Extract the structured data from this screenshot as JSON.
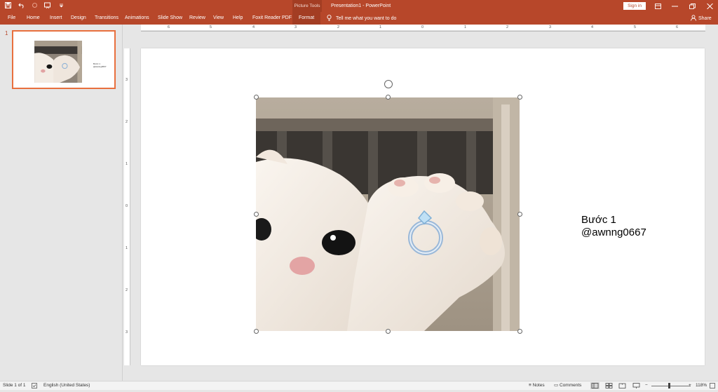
{
  "titlebar": {
    "context_tab": "Picture Tools",
    "doc_title": "Presentation1  -  PowerPoint",
    "sign_in": "Sign in"
  },
  "ribbon": {
    "tabs": [
      "File",
      "Home",
      "Insert",
      "Design",
      "Transitions",
      "Animations",
      "Slide Show",
      "Review",
      "View",
      "Help",
      "Foxit Reader PDF"
    ],
    "format_tab": "Format",
    "tell_me": "Tell me what you want to do",
    "share": "Share"
  },
  "thumbnails": {
    "slide_number": "1",
    "thumb_text_line1": "Bước 1",
    "thumb_text_line2": "@awnng0667"
  },
  "ruler": {
    "h_labels": [
      "6",
      "5",
      "4",
      "3",
      "2",
      "1",
      "0",
      "1",
      "2",
      "3",
      "4",
      "5",
      "6"
    ],
    "v_labels": [
      "3",
      "2",
      "1",
      "0",
      "1",
      "2",
      "3"
    ]
  },
  "slide": {
    "text_line1": "Bước 1",
    "text_line2": "@awnng0667"
  },
  "statusbar": {
    "slide_info": "Slide 1 of 1",
    "language": "English (United States)",
    "notes": "Notes",
    "comments": "Comments",
    "zoom_minus": "−",
    "zoom_plus": "+",
    "zoom_level": "118%"
  },
  "colors": {
    "accent": "#b7472a",
    "selection": "#e8703e"
  },
  "icons": [
    "save-icon",
    "undo-icon",
    "redo-icon",
    "start-from-beginning-icon",
    "customize-qat-icon",
    "ribbon-display-icon",
    "minimize-icon",
    "restore-icon",
    "close-icon",
    "lightbulb-icon",
    "share-person-icon",
    "spell-check-icon",
    "notes-icon",
    "comments-icon",
    "normal-view-icon",
    "slide-sorter-icon",
    "reading-view-icon",
    "slideshow-view-icon",
    "rotate-handle-icon"
  ]
}
